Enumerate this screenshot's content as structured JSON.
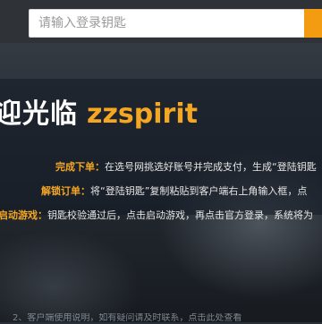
{
  "search": {
    "placeholder": "请输入登录钥匙"
  },
  "hero": {
    "welcome_text": "迎光临",
    "username": "zzspirit"
  },
  "steps": [
    {
      "label": "完成下单：",
      "text": "在选号网挑选好账号并完成支付，生成“登陆钥匙"
    },
    {
      "label": "解锁订单：",
      "text": "将“登陆钥匙”复制粘贴到客户端右上角输入框，点"
    },
    {
      "label": "启动游戏：",
      "text": "钥匙校验通过后，点击启动游戏，再点击官方登录，系统将为"
    }
  ],
  "footer": {
    "text": "2、客户端使用说明，如有疑问请及时联系，点击此处查看"
  },
  "colors": {
    "accent": "#f5a623",
    "topbar": "#2f3338"
  }
}
